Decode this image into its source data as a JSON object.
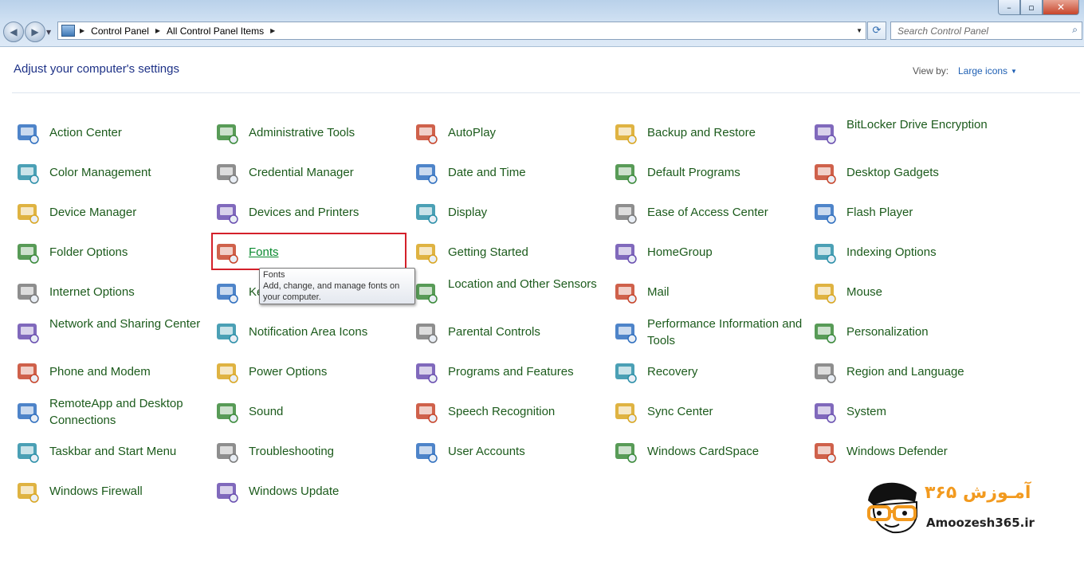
{
  "window": {
    "controls": {
      "minimize": "–",
      "maximize": "▫",
      "close": "✕"
    }
  },
  "addressbar": {
    "breadcrumbs": [
      "Control Panel",
      "All Control Panel Items"
    ]
  },
  "search": {
    "placeholder": "Search Control Panel"
  },
  "header": {
    "title": "Adjust your computer's settings",
    "view_by_label": "View by:",
    "view_by_value": "Large icons"
  },
  "items": [
    {
      "label": "Action Center",
      "icon": "action-center-flag-icon"
    },
    {
      "label": "Administrative Tools",
      "icon": "admin-tools-icon"
    },
    {
      "label": "AutoPlay",
      "icon": "autoplay-icon"
    },
    {
      "label": "Backup and Restore",
      "icon": "backup-restore-icon"
    },
    {
      "label": "BitLocker Drive Encryption",
      "icon": "bitlocker-key-icon"
    },
    {
      "label": "Color Management",
      "icon": "color-management-icon"
    },
    {
      "label": "Credential Manager",
      "icon": "credential-vault-icon"
    },
    {
      "label": "Date and Time",
      "icon": "calendar-clock-icon"
    },
    {
      "label": "Default Programs",
      "icon": "default-programs-icon"
    },
    {
      "label": "Desktop Gadgets",
      "icon": "desktop-gadgets-icon"
    },
    {
      "label": "Device Manager",
      "icon": "device-manager-icon"
    },
    {
      "label": "Devices and Printers",
      "icon": "printer-icon"
    },
    {
      "label": "Display",
      "icon": "display-monitor-icon"
    },
    {
      "label": "Ease of Access Center",
      "icon": "ease-of-access-icon"
    },
    {
      "label": "Flash Player",
      "icon": "flash-player-icon"
    },
    {
      "label": "Folder Options",
      "icon": "folder-options-icon"
    },
    {
      "label": "Fonts",
      "icon": "fonts-folder-icon"
    },
    {
      "label": "Getting Started",
      "icon": "getting-started-icon"
    },
    {
      "label": "HomeGroup",
      "icon": "homegroup-icon"
    },
    {
      "label": "Indexing Options",
      "icon": "indexing-magnifier-icon"
    },
    {
      "label": "Internet Options",
      "icon": "internet-globe-icon"
    },
    {
      "label": "Ke",
      "icon": "keyboard-icon"
    },
    {
      "label": "Location and Other Sensors",
      "icon": "location-sensors-icon"
    },
    {
      "label": "Mail",
      "icon": "mail-icon"
    },
    {
      "label": "Mouse",
      "icon": "mouse-icon"
    },
    {
      "label": "Network and Sharing Center",
      "icon": "network-sharing-icon"
    },
    {
      "label": "Notification Area Icons",
      "icon": "notification-area-icon"
    },
    {
      "label": "Parental Controls",
      "icon": "parental-controls-icon"
    },
    {
      "label": "Performance Information and Tools",
      "icon": "performance-monitor-icon"
    },
    {
      "label": "Personalization",
      "icon": "personalization-icon"
    },
    {
      "label": "Phone and Modem",
      "icon": "phone-modem-icon"
    },
    {
      "label": "Power Options",
      "icon": "power-options-icon"
    },
    {
      "label": "Programs and Features",
      "icon": "programs-features-icon"
    },
    {
      "label": "Recovery",
      "icon": "recovery-icon"
    },
    {
      "label": "Region and Language",
      "icon": "region-language-globe-icon"
    },
    {
      "label": "RemoteApp and Desktop Connections",
      "icon": "remoteapp-icon"
    },
    {
      "label": "Sound",
      "icon": "speaker-icon"
    },
    {
      "label": "Speech Recognition",
      "icon": "microphone-icon"
    },
    {
      "label": "Sync Center",
      "icon": "sync-center-icon"
    },
    {
      "label": "System",
      "icon": "system-computer-icon"
    },
    {
      "label": "Taskbar and Start Menu",
      "icon": "taskbar-icon"
    },
    {
      "label": "Troubleshooting",
      "icon": "troubleshooting-icon"
    },
    {
      "label": "User Accounts",
      "icon": "user-accounts-icon"
    },
    {
      "label": "Windows CardSpace",
      "icon": "cardspace-icon"
    },
    {
      "label": "Windows Defender",
      "icon": "defender-castle-icon"
    },
    {
      "label": "Windows Firewall",
      "icon": "firewall-brick-icon"
    },
    {
      "label": "Windows Update",
      "icon": "windows-update-icon"
    }
  ],
  "tooltip": {
    "title": "Fonts",
    "text": "Add, change, and manage fonts on your computer."
  },
  "logo": {
    "persian_text": "آمـوزش ۳۶۵",
    "site": "Amoozesh365.ir"
  },
  "colors": {
    "link_green": "#1c5b1c",
    "title_blue": "#1e3287",
    "highlight_red": "#d4202a",
    "logo_orange": "#f29a1f"
  }
}
